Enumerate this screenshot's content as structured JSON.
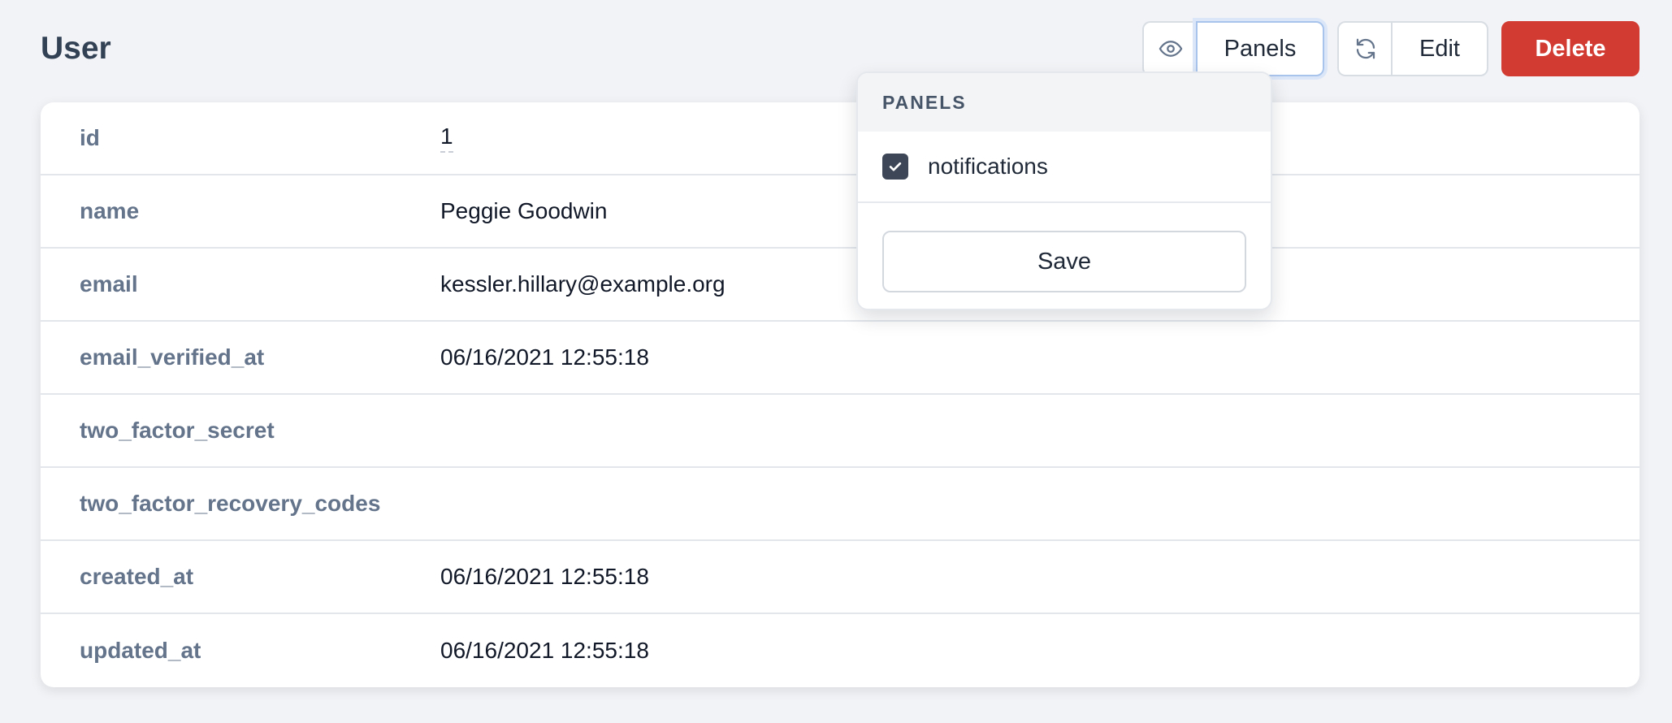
{
  "header": {
    "title": "User"
  },
  "toolbar": {
    "view_icon": "eye-icon",
    "panels_label": "Panels",
    "refresh_icon": "refresh-icon",
    "edit_label": "Edit",
    "delete_label": "Delete"
  },
  "colors": {
    "delete_bg": "#d23b32",
    "checkbox_bg": "#3c4656",
    "focus_ring": "#a9c4ec"
  },
  "fields": [
    {
      "name": "id",
      "value": "1"
    },
    {
      "name": "name",
      "value": "Peggie Goodwin"
    },
    {
      "name": "email",
      "value": "kessler.hillary@example.org"
    },
    {
      "name": "email_verified_at",
      "value": "06/16/2021 12:55:18"
    },
    {
      "name": "two_factor_secret",
      "value": ""
    },
    {
      "name": "two_factor_recovery_codes",
      "value": ""
    },
    {
      "name": "created_at",
      "value": "06/16/2021 12:55:18"
    },
    {
      "name": "updated_at",
      "value": "06/16/2021 12:55:18"
    }
  ],
  "panels_dropdown": {
    "header": "PANELS",
    "items": [
      {
        "label": "notifications",
        "checked": true
      }
    ],
    "save_label": "Save"
  }
}
